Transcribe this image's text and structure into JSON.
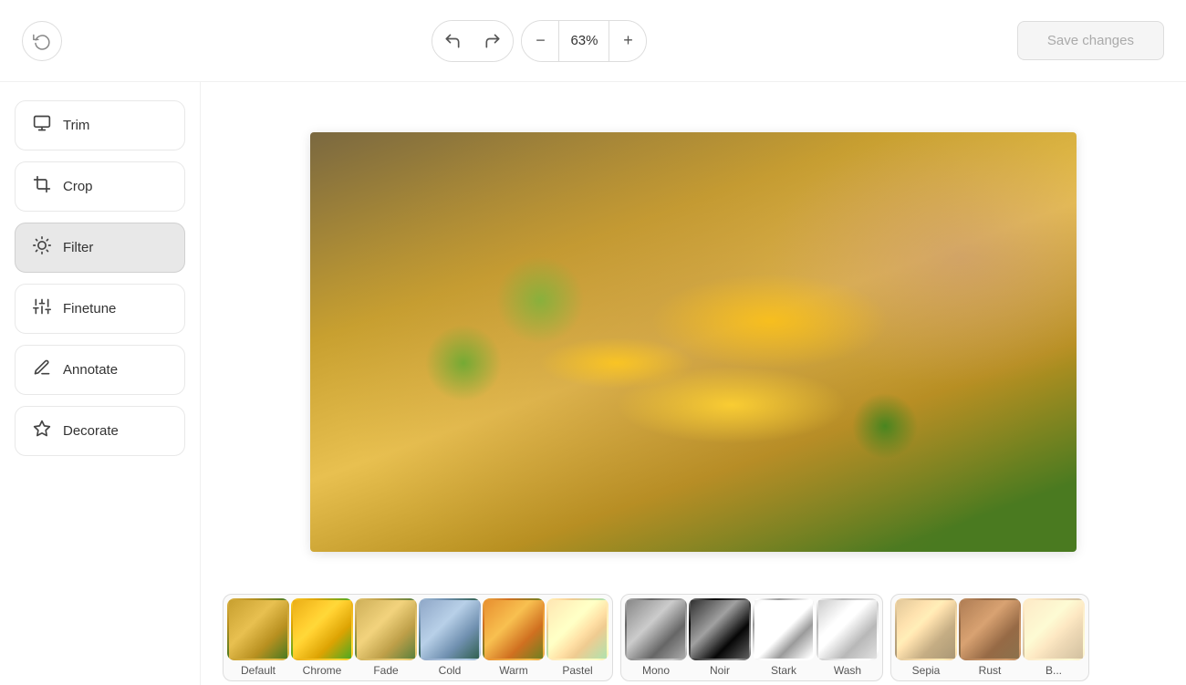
{
  "header": {
    "history_title": "History",
    "undo_label": "↺",
    "redo_label": "↻",
    "zoom_minus": "−",
    "zoom_value": "63%",
    "zoom_plus": "+",
    "save_label": "Save changes"
  },
  "sidebar": {
    "items": [
      {
        "id": "trim",
        "label": "Trim",
        "icon": "trim"
      },
      {
        "id": "crop",
        "label": "Crop",
        "icon": "crop"
      },
      {
        "id": "filter",
        "label": "Filter",
        "icon": "filter",
        "active": true
      },
      {
        "id": "finetune",
        "label": "Finetune",
        "icon": "finetune"
      },
      {
        "id": "annotate",
        "label": "Annotate",
        "icon": "annotate"
      },
      {
        "id": "decorate",
        "label": "Decorate",
        "icon": "decorate"
      }
    ]
  },
  "filters": {
    "group1": [
      {
        "id": "default",
        "label": "Default"
      },
      {
        "id": "chrome",
        "label": "Chrome"
      },
      {
        "id": "fade",
        "label": "Fade"
      },
      {
        "id": "cold",
        "label": "Cold"
      },
      {
        "id": "warm",
        "label": "Warm"
      },
      {
        "id": "pastel",
        "label": "Pastel"
      }
    ],
    "group2": [
      {
        "id": "mono",
        "label": "Mono"
      },
      {
        "id": "noir",
        "label": "Noir"
      },
      {
        "id": "stark",
        "label": "Stark"
      },
      {
        "id": "wash",
        "label": "Wash"
      }
    ],
    "group3": [
      {
        "id": "sepia",
        "label": "Sepia"
      },
      {
        "id": "rust",
        "label": "Rust"
      },
      {
        "id": "b",
        "label": "B..."
      }
    ]
  }
}
